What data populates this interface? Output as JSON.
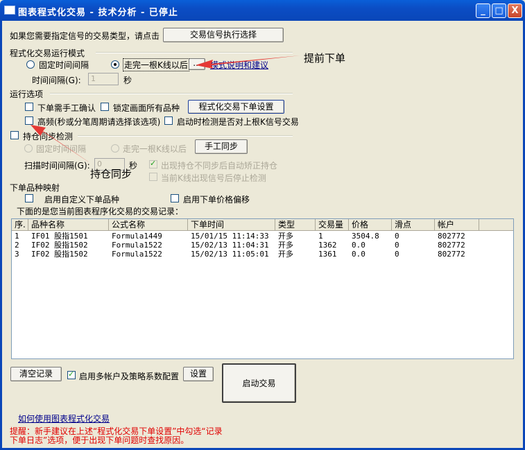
{
  "window": {
    "title": "图表程式化交易 - 技术分析 - 已停止",
    "min": "_",
    "max": "□",
    "close": "X"
  },
  "top": {
    "prompt": "如果您需要指定信号的交易类型，请点击",
    "signal_button": "交易信号执行选择"
  },
  "mode": {
    "header": "程式化交易运行模式",
    "fixed_interval": "固定时间间隔",
    "after_kline": "走完一根K线以后",
    "more_button": "...",
    "link": "模式说明和建议",
    "interval_label": "时间间隔(G):",
    "interval_value": "1",
    "interval_unit": "秒"
  },
  "options": {
    "header": "运行选项",
    "manual_confirm": "下单需手工确认",
    "lock_all": "锁定画面所有品种",
    "order_settings_button": "程式化交易下单设置",
    "high_freq": "高频(秒或分笔周期请选择该选项)",
    "check_signal": "启动时检测是否对上根K信号交易"
  },
  "position": {
    "header": "持仓同步检测",
    "fixed_interval": "固定时间间隔",
    "after_kline": "走完一根K线以后",
    "manual_sync_button": "手工同步",
    "scan_label": "扫描时间间隔(G):",
    "scan_value": "0",
    "scan_unit": "秒",
    "auto_correct": "出现持仓不同步后自动矫正持仓",
    "stop_check": "当前K线出现信号后停止检测"
  },
  "mapping": {
    "header": "下单品种映射",
    "custom_symbol": "启用自定义下单品种",
    "price_offset": "启用下单价格偏移",
    "records_label": "下面的是您当前图表程序化交易的交易记录："
  },
  "table": {
    "columns": [
      "序.",
      "品种名称",
      "公式名称",
      "下单时间",
      "类型",
      "交易量",
      "价格",
      "滑点",
      "帐户"
    ],
    "rows": [
      [
        "1",
        "IF01 股指1501",
        "Formula1449",
        "15/01/15 11:14:33",
        "开多",
        "1",
        "3504.8",
        "0",
        "802772"
      ],
      [
        "2",
        "IF02 股指1502",
        "Formula1522",
        "15/02/13 11:04:31",
        "开多",
        "1362",
        "0.0",
        "0",
        "802772"
      ],
      [
        "3",
        "IF02 股指1502",
        "Formula1522",
        "15/02/13 11:05:01",
        "开多",
        "1361",
        "0.0",
        "0",
        "802772"
      ]
    ]
  },
  "bottom": {
    "clear_button": "清空记录",
    "multi_account": "启用多帐户及策略系数配置",
    "settings_button": "设置",
    "start_button": "启动交易",
    "help_link": "如何使用图表程式化交易",
    "tip_line1": "提醒：新手建议在上述“程式化交易下单设置”中勾选“记录",
    "tip_line2": "下单日志”选项，便于出现下单问题时查找原因。"
  },
  "annotations": {
    "advance_order": "提前下单",
    "position_sync": "持仓同步"
  },
  "colors": {
    "titlebar": "#0A5FD8",
    "background": "#ECE9D8",
    "tip_text": "#E00000",
    "arrow": "#E53935"
  }
}
